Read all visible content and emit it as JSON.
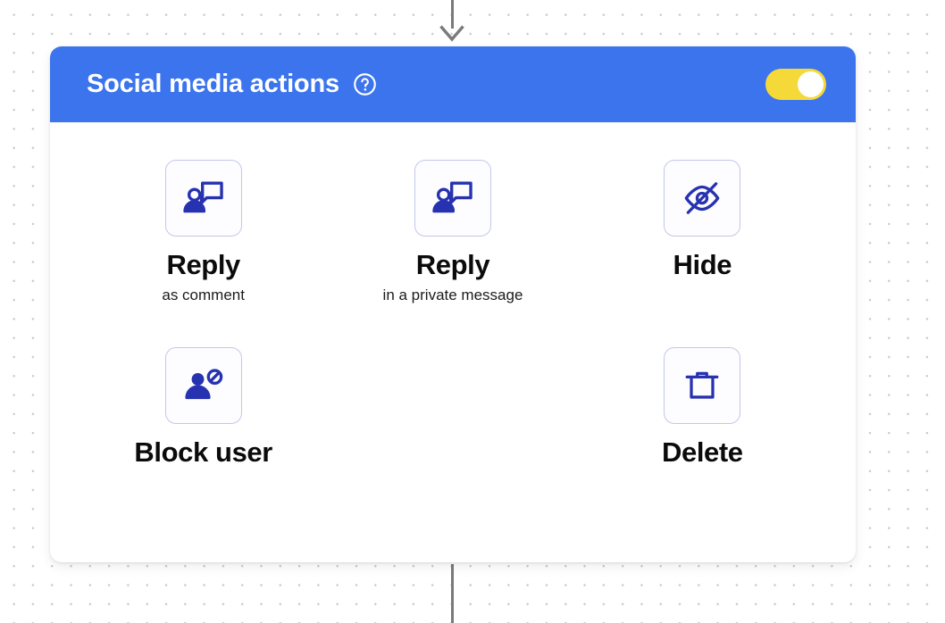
{
  "canvas": {
    "background_color": "#ffffff",
    "dot_color": "#c9cace",
    "connector_color": "#7a7a7a"
  },
  "node": {
    "header": {
      "title": "Social media actions",
      "background_color": "#3b74ec",
      "title_color": "#ffffff",
      "help_icon": "question-circle-icon",
      "toggle": {
        "name": "enabled-toggle",
        "state": "on",
        "track_color": "#f5d938",
        "knob_color": "#ffffff"
      }
    },
    "body": {
      "icon_color": "#2732b0",
      "tile_border_color": "#c3c7ea",
      "actions": [
        {
          "id": "reply-as-comment",
          "icon": "person-speech-bubble-icon",
          "label": "Reply",
          "sublabel": "as comment"
        },
        {
          "id": "reply-private-message",
          "icon": "person-speech-bubble-icon",
          "label": "Reply",
          "sublabel": "in a private message"
        },
        {
          "id": "hide",
          "icon": "eye-off-icon",
          "label": "Hide",
          "sublabel": ""
        },
        {
          "id": "block-user",
          "icon": "person-block-icon",
          "label": "Block user",
          "sublabel": ""
        },
        {
          "id": "spacer",
          "icon": "",
          "label": "",
          "sublabel": ""
        },
        {
          "id": "delete",
          "icon": "trash-icon",
          "label": "Delete",
          "sublabel": ""
        }
      ]
    }
  }
}
